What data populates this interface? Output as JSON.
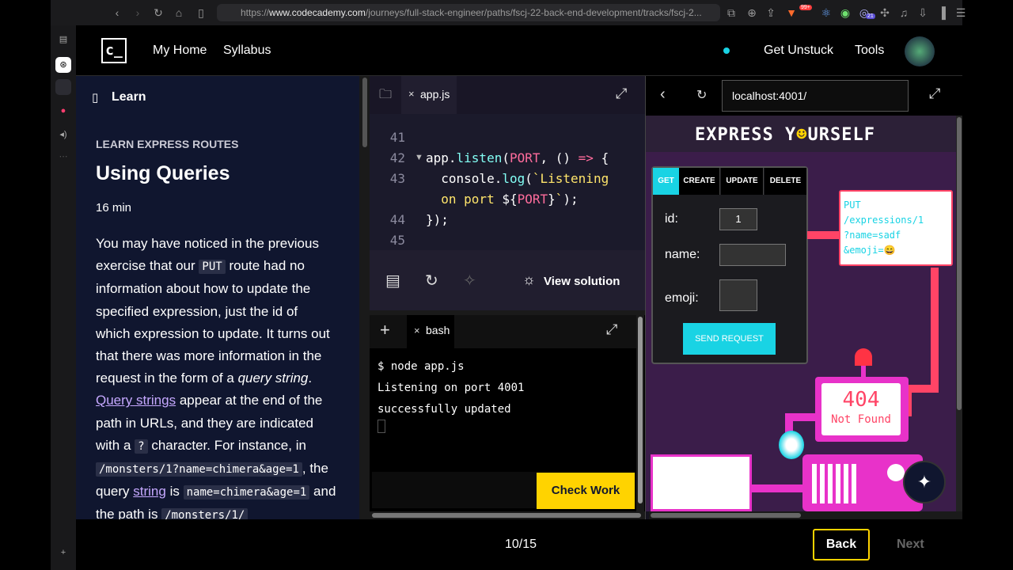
{
  "browser": {
    "url_prefix": "https://",
    "url_host": "www.codecademy.com",
    "url_path": "/journeys/full-stack-engineer/paths/fscj-22-back-end-development/tracks/fscj-2...",
    "badge_count": "21",
    "shield_badge": "99+"
  },
  "header": {
    "logo_text": "c_",
    "nav_home": "My Home",
    "nav_syllabus": "Syllabus",
    "get_unstuck": "Get Unstuck",
    "tools": "Tools"
  },
  "learn": {
    "tab_label": "Learn",
    "eyebrow": "LEARN EXPRESS ROUTES",
    "title": "Using Queries",
    "duration": "16 min",
    "para": [
      "You may have noticed in the previous",
      "exercise that our",
      "PUT",
      "route had no",
      "information about how to update the",
      "specified expression, just the id of",
      "which expression to update. It turns out",
      "that there was more information in the",
      "request in the form of a",
      "query string",
      "Query strings",
      "appear at the end of the",
      "path in URLs, and they are indicated",
      "with a",
      "?",
      "character. For instance, in",
      "/monsters/1?name=chimera&age=1",
      ", the",
      "query",
      "string",
      "is",
      "name=chimera&age=1",
      "and",
      "the path is",
      "/monsters/1/"
    ]
  },
  "editor": {
    "file_tab": "app.js",
    "lines": [
      "41",
      "42",
      "43",
      "44",
      "45"
    ],
    "view_solution": "View solution"
  },
  "terminal": {
    "tab": "bash",
    "lines": [
      "$ node app.js",
      "Listening on port 4001",
      "successfully updated"
    ],
    "check_work": "Check Work"
  },
  "preview": {
    "address": "localhost:4001/",
    "app_title": "EXPRESS Y",
    "app_title_end": "URSELF",
    "tabs": [
      "GET",
      "CREATE",
      "UPDATE",
      "DELETE"
    ],
    "id_label": "id:",
    "id_value": "1",
    "name_label": "name:",
    "emoji_label": "emoji:",
    "send_button": "SEND REQUEST",
    "request_line1": "PUT",
    "request_line2": "/expressions/1",
    "request_line3": "?name=sadf",
    "request_line4": "&emoji=",
    "status_code": "404",
    "status_text": "Not Found"
  },
  "footer": {
    "progress": "10/15",
    "back": "Back",
    "next": "Next"
  },
  "colors": {
    "cyan": "#19d3e4",
    "pink": "#e832c9",
    "yellow": "#ffd300"
  }
}
